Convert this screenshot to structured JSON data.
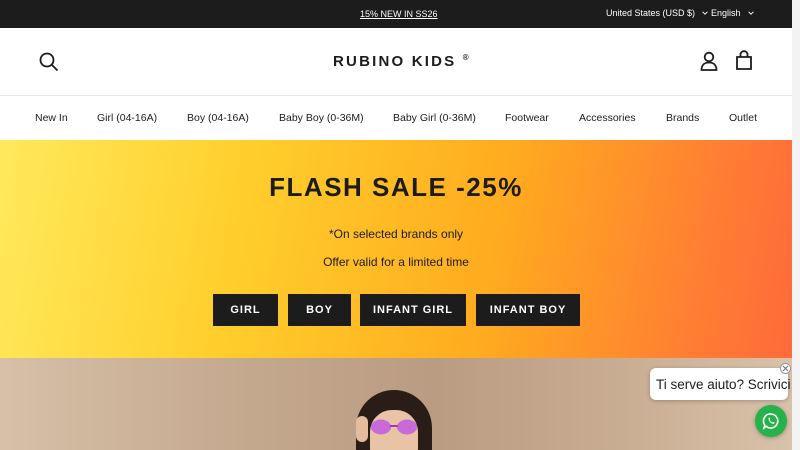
{
  "announcement": {
    "promo": "15% NEW IN SS26",
    "currency": "United States (USD $)",
    "language": "English"
  },
  "header": {
    "logo": "RUBINO KIDS",
    "logo_mark": "®",
    "icons": [
      "search-icon",
      "account-icon",
      "cart-icon"
    ]
  },
  "nav": {
    "items": [
      "New In",
      "Girl (04-16A)",
      "Boy (04-16A)",
      "Baby Boy (0-36M)",
      "Baby Girl (0-36M)",
      "Footwear",
      "Accessories",
      "Brands",
      "Outlet"
    ]
  },
  "hero": {
    "title": "FLASH SALE -25%",
    "line1": "*On selected brands only",
    "line2": "Offer valid for a limited time",
    "buttons": [
      "GIRL",
      "BOY",
      "INFANT GIRL",
      "INFANT BOY"
    ]
  },
  "chat": {
    "bubble": "Ti serve aiuto? Scrivici",
    "icon": "whatsapp-icon"
  },
  "colors": {
    "dark": "#1c1c1c",
    "hero_start": "#ffe95c",
    "hero_end": "#ff6a3a",
    "chat_green": "#25b24a"
  }
}
